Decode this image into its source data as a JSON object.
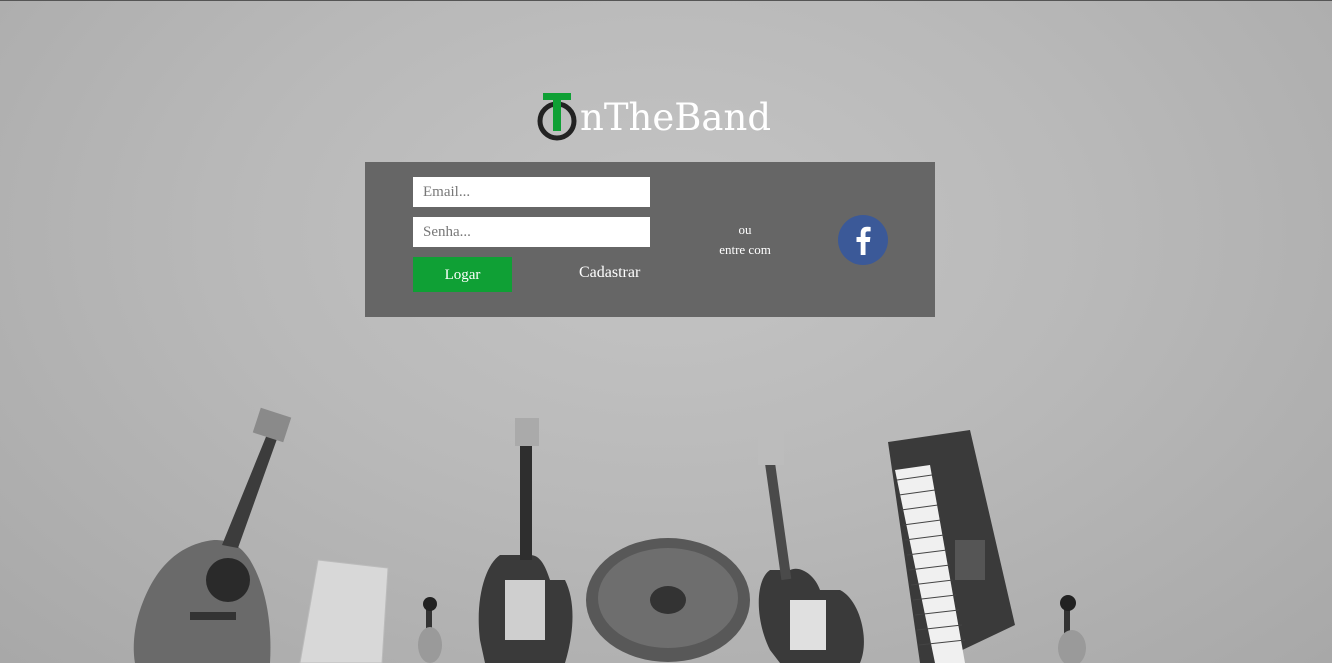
{
  "brand": {
    "name": "nTheBand",
    "mark_letter": "T",
    "mark_color": "#0fa035"
  },
  "login": {
    "email_placeholder": "Email...",
    "password_placeholder": "Senha...",
    "login_label": "Logar",
    "signup_label": "Cadastrar",
    "or_label": "ou",
    "enter_with_label": "entre com"
  },
  "social": {
    "facebook_icon": "facebook-icon",
    "facebook_color": "#3b5998"
  },
  "colors": {
    "panel": "#666666",
    "accent": "#0fa035"
  }
}
